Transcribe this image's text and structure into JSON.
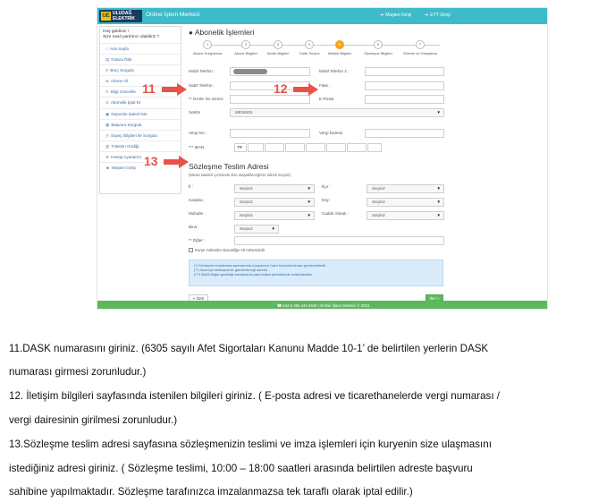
{
  "header": {
    "logo_line1": "ULUDAĞ",
    "logo_line2": "ELEKTRİK",
    "logo_mark": "UE",
    "app_title": "Online İşlem Merkezi",
    "login_link": "Müşteri Girişi",
    "eyt_link": "EYT Girişi"
  },
  "sidebar": {
    "greeting_line1": "Hoş geldiniz !",
    "greeting_line2": "Size nasıl yardımcı olabiliriz ?",
    "items": [
      {
        "label": "Ana Sayfa"
      },
      {
        "label": "Fatura Öde"
      },
      {
        "label": "Borç Sorgula"
      },
      {
        "label": "Abone Ol"
      },
      {
        "label": "Bilgi Güncelle"
      },
      {
        "label": "Abonelik İptal Et"
      },
      {
        "label": "Depozito İadesi İste"
      },
      {
        "label": "Başvuru Sorgula"
      },
      {
        "label": "Sayaç Bilgileri ile Sorgula"
      },
      {
        "label": "Tüketim Grafiği"
      },
      {
        "label": "Hesap Ayarlarım"
      },
      {
        "label": "Müşteri Girişi"
      }
    ]
  },
  "main": {
    "title": "Abonelik İşlemleri",
    "steps": [
      {
        "num": "1",
        "label": "Abone Sorgulama",
        "active": false
      },
      {
        "num": "2",
        "label": "Abone Bilgileri",
        "active": false
      },
      {
        "num": "3",
        "label": "Kimlik Bilgileri",
        "active": false
      },
      {
        "num": "4",
        "label": "Tarife Seçimi",
        "active": false
      },
      {
        "num": "5",
        "label": "İletişim Bilgileri",
        "active": true
      },
      {
        "num": "6",
        "label": "Sözleşme Bilgileri",
        "active": false
      },
      {
        "num": "7",
        "label": "Ödeme ve Onaylama",
        "active": false
      }
    ],
    "contact": {
      "mobile_label": "Mobil Telefon :",
      "mobile2_label": "Mobil Telefon 2 :",
      "landline_label": "Sabit Telefon :",
      "fax_label": "Faks :",
      "dask_label": "** DASK No Giriniz",
      "email_label": "E-Posta",
      "sector_label": "Sektör",
      "sector_value": "MESKEN",
      "tax_no_label": "Vergi No :",
      "tax_office_label": "Vergi Dairesi",
      "iban_label": "*** IBAN :",
      "iban_prefix": "TR"
    },
    "delivery": {
      "title": "Sözleşme Teslim Adresi",
      "subtitle": "(Mesai saatleri içerisinde size ulaşabileceğimiz adresi seçiniz)",
      "il_label": "İl :",
      "ilce_label": "İlçe :",
      "kasaba_label": "Kasaba :",
      "koy_label": "Köy :",
      "mahalle_label": "Mahalle :",
      "cadde_label": "Cadde Sokak :",
      "bina_label": "Bina :",
      "diger_label": "** Diğer :",
      "select_placeholder": "Seçiniz",
      "courier_label": "Kurye Adresimi Aboneliğe Ait Adresimdir"
    },
    "notes": [
      "(*) Sözleşme imzalanma aşamasında kooyasının hazır bulundurulması gerekmektedir.",
      "(**) İmza için sözleşmenin gönderileceği adresti",
      "(***) IBAN Bilgisi gerektiği zamanlarda para iadesi işlemlerinde kullanılacaktır."
    ],
    "back_label": "« Geri",
    "next_label": "İleri »"
  },
  "footer": {
    "text": "☎ 444 6 355 444 6646 | Online İşlem Merkezi © 2015"
  },
  "callouts": {
    "c11": "11",
    "c12": "12",
    "c13": "13"
  },
  "instructions": [
    "11.DASK numarasını giriniz. (6305 sayılı Afet Sigortaları Kanunu Madde 10-1’ de belirtilen yerlerin DASK",
    "numarası girmesi zorunludur.)",
    "12. İletişim bilgileri sayfasında istenilen bilgileri giriniz. ( E-posta adresi ve ticarethanelerde vergi numarası /",
    "vergi dairesinin girilmesi zorunludur.)",
    "13.Sözleşme teslim adresi sayfasına sözleşmenizin teslimi ve imza işlemleri için kuryenin size ulaşmasını",
    "istediğiniz adresi giriniz. ( Sözleşme teslimi, 10:00 – 18:00 saatleri arasında belirtilen adreste başvuru",
    "sahibine yapılmaktadır. Sözleşme tarafınızca imzalanmazsa tek taraflı olarak iptal edilir.)"
  ],
  "colors": {
    "topbar": "#3dbbc8",
    "active_step": "#f6a31a",
    "callout": "#e8524a",
    "footer": "#5cb85c"
  }
}
